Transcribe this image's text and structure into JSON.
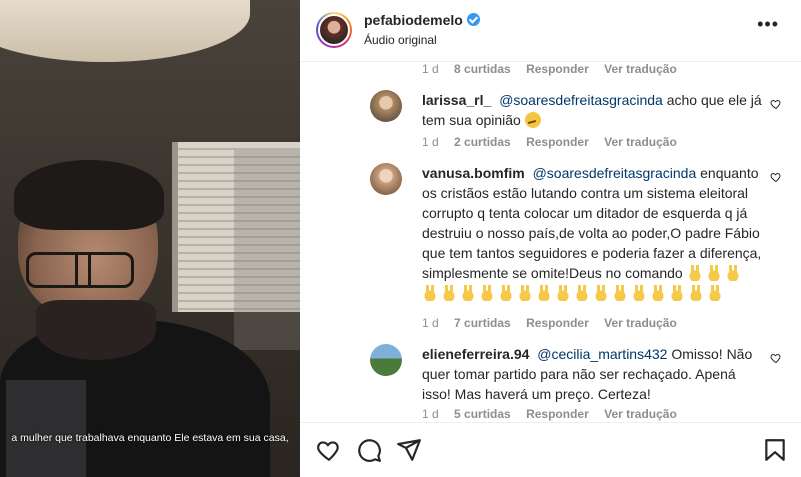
{
  "video": {
    "subtitle": "a mulher que trabalhava enquanto Ele estava em sua casa,"
  },
  "post": {
    "username": "pefabiodemelo",
    "audio": "Áudio original",
    "more_icon": "ellipsis-icon"
  },
  "comments": {
    "top_meta": {
      "time": "1 d",
      "likes": "8 curtidas",
      "reply": "Responder",
      "translate": "Ver tradução"
    },
    "items": [
      {
        "user": "larissa_rl_",
        "mention": "@soaresdefreitasgracinda",
        "text": "acho que ele já tem sua opinião",
        "time": "1 d",
        "likes": "2 curtidas",
        "reply": "Responder",
        "translate": "Ver tradução"
      },
      {
        "user": "vanusa.bomfim",
        "mention": "@soaresdefreitasgracinda",
        "text": "enquanto os cristãos estão lutando contra um sistema eleitoral corrupto q tenta colocar um ditador de esquerda q já destruiu o nosso país,de volta ao poder,O padre Fábio que tem tantos seguidores e poderia fazer a diferença, simplesmente se omite!Deus no comando",
        "emoji_count": 19,
        "time": "1 d",
        "likes": "7 curtidas",
        "reply": "Responder",
        "translate": "Ver tradução"
      },
      {
        "user": "elieneferreira.94",
        "mention": "@cecilia_martins432",
        "text": "Omisso! Não quer tomar partido para não ser rechaçado. Apená isso! Mas haverá um preço. Certeza!",
        "time": "1 d",
        "likes": "5 curtidas",
        "reply": "Responder",
        "translate": "Ver tradução"
      }
    ]
  },
  "actions": {
    "like_icon": "heart-icon",
    "comment_icon": "comment-icon",
    "share_icon": "send-icon",
    "save_icon": "bookmark-icon"
  }
}
